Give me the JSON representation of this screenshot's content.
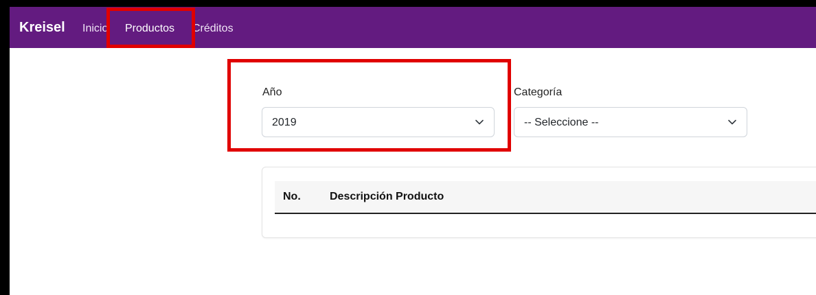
{
  "navbar": {
    "brand": "Kreisel",
    "items": [
      {
        "label": "Inicio"
      },
      {
        "label": "Productos"
      },
      {
        "label": "Créditos"
      }
    ],
    "background": "#631b80"
  },
  "filters": {
    "year": {
      "label": "Año",
      "value": "2019"
    },
    "category": {
      "label": "Categoría",
      "value": "-- Seleccione --"
    }
  },
  "table": {
    "columns": [
      "No.",
      "Descripción Producto"
    ]
  },
  "highlight_color": "#e00000",
  "icons": {
    "select_arrow": "chevron-down-icon"
  }
}
